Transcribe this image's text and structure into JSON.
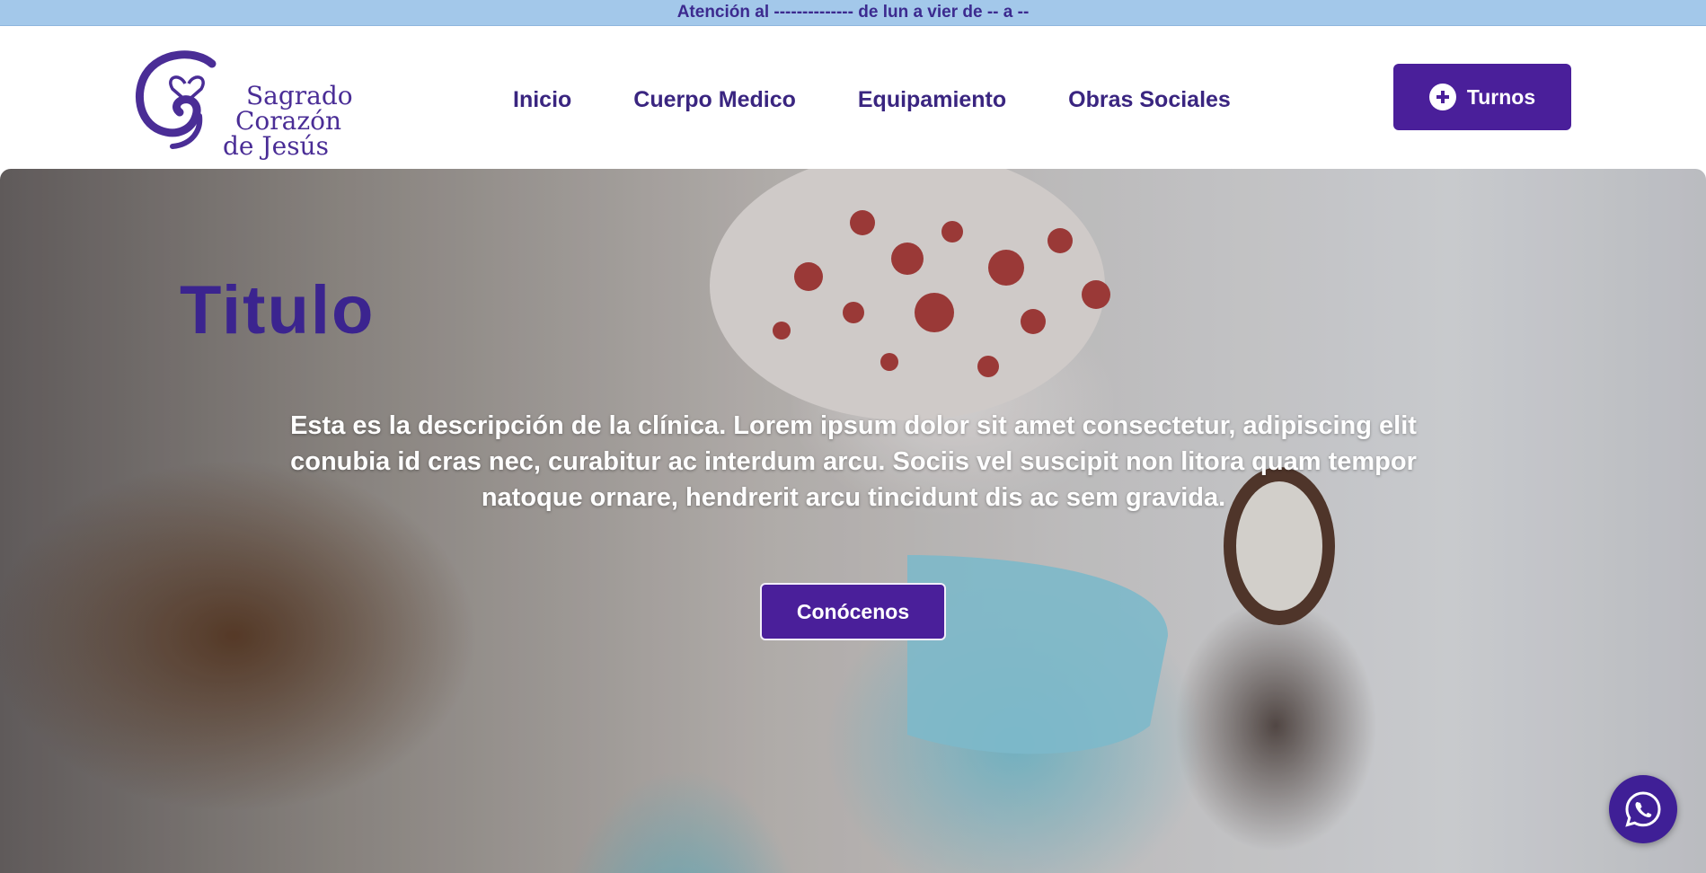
{
  "topbar": {
    "text": "Atención al -------------- de lun a vier de -- a --"
  },
  "brand": {
    "line1": "Sagrado",
    "line2": "Corazón",
    "line3": "de Jesús",
    "color": "#4a2d96"
  },
  "nav": {
    "items": [
      {
        "label": "Inicio"
      },
      {
        "label": "Cuerpo Medico"
      },
      {
        "label": "Equipamiento"
      },
      {
        "label": "Obras Sociales"
      }
    ]
  },
  "header": {
    "cta_label": "Turnos",
    "cta_icon": "plus-circle-icon"
  },
  "hero": {
    "title": "Titulo",
    "description": "Esta es la descripción de la clínica. Lorem ipsum dolor sit amet consectetur, adipiscing elit conubia id cras nec, curabitur ac interdum arcu. Sociis vel suscipit non litora quam tempor natoque ornare, hendrerit arcu tincidunt dis ac sem gravida.",
    "button_label": "Conócenos",
    "background": "photo of medical worker tying surgical cap"
  },
  "floating": {
    "icon": "whatsapp-icon"
  },
  "colors": {
    "primary": "#4a1f9a",
    "topbar_bg": "#a3c8ea",
    "nav_text": "#3a2580"
  }
}
